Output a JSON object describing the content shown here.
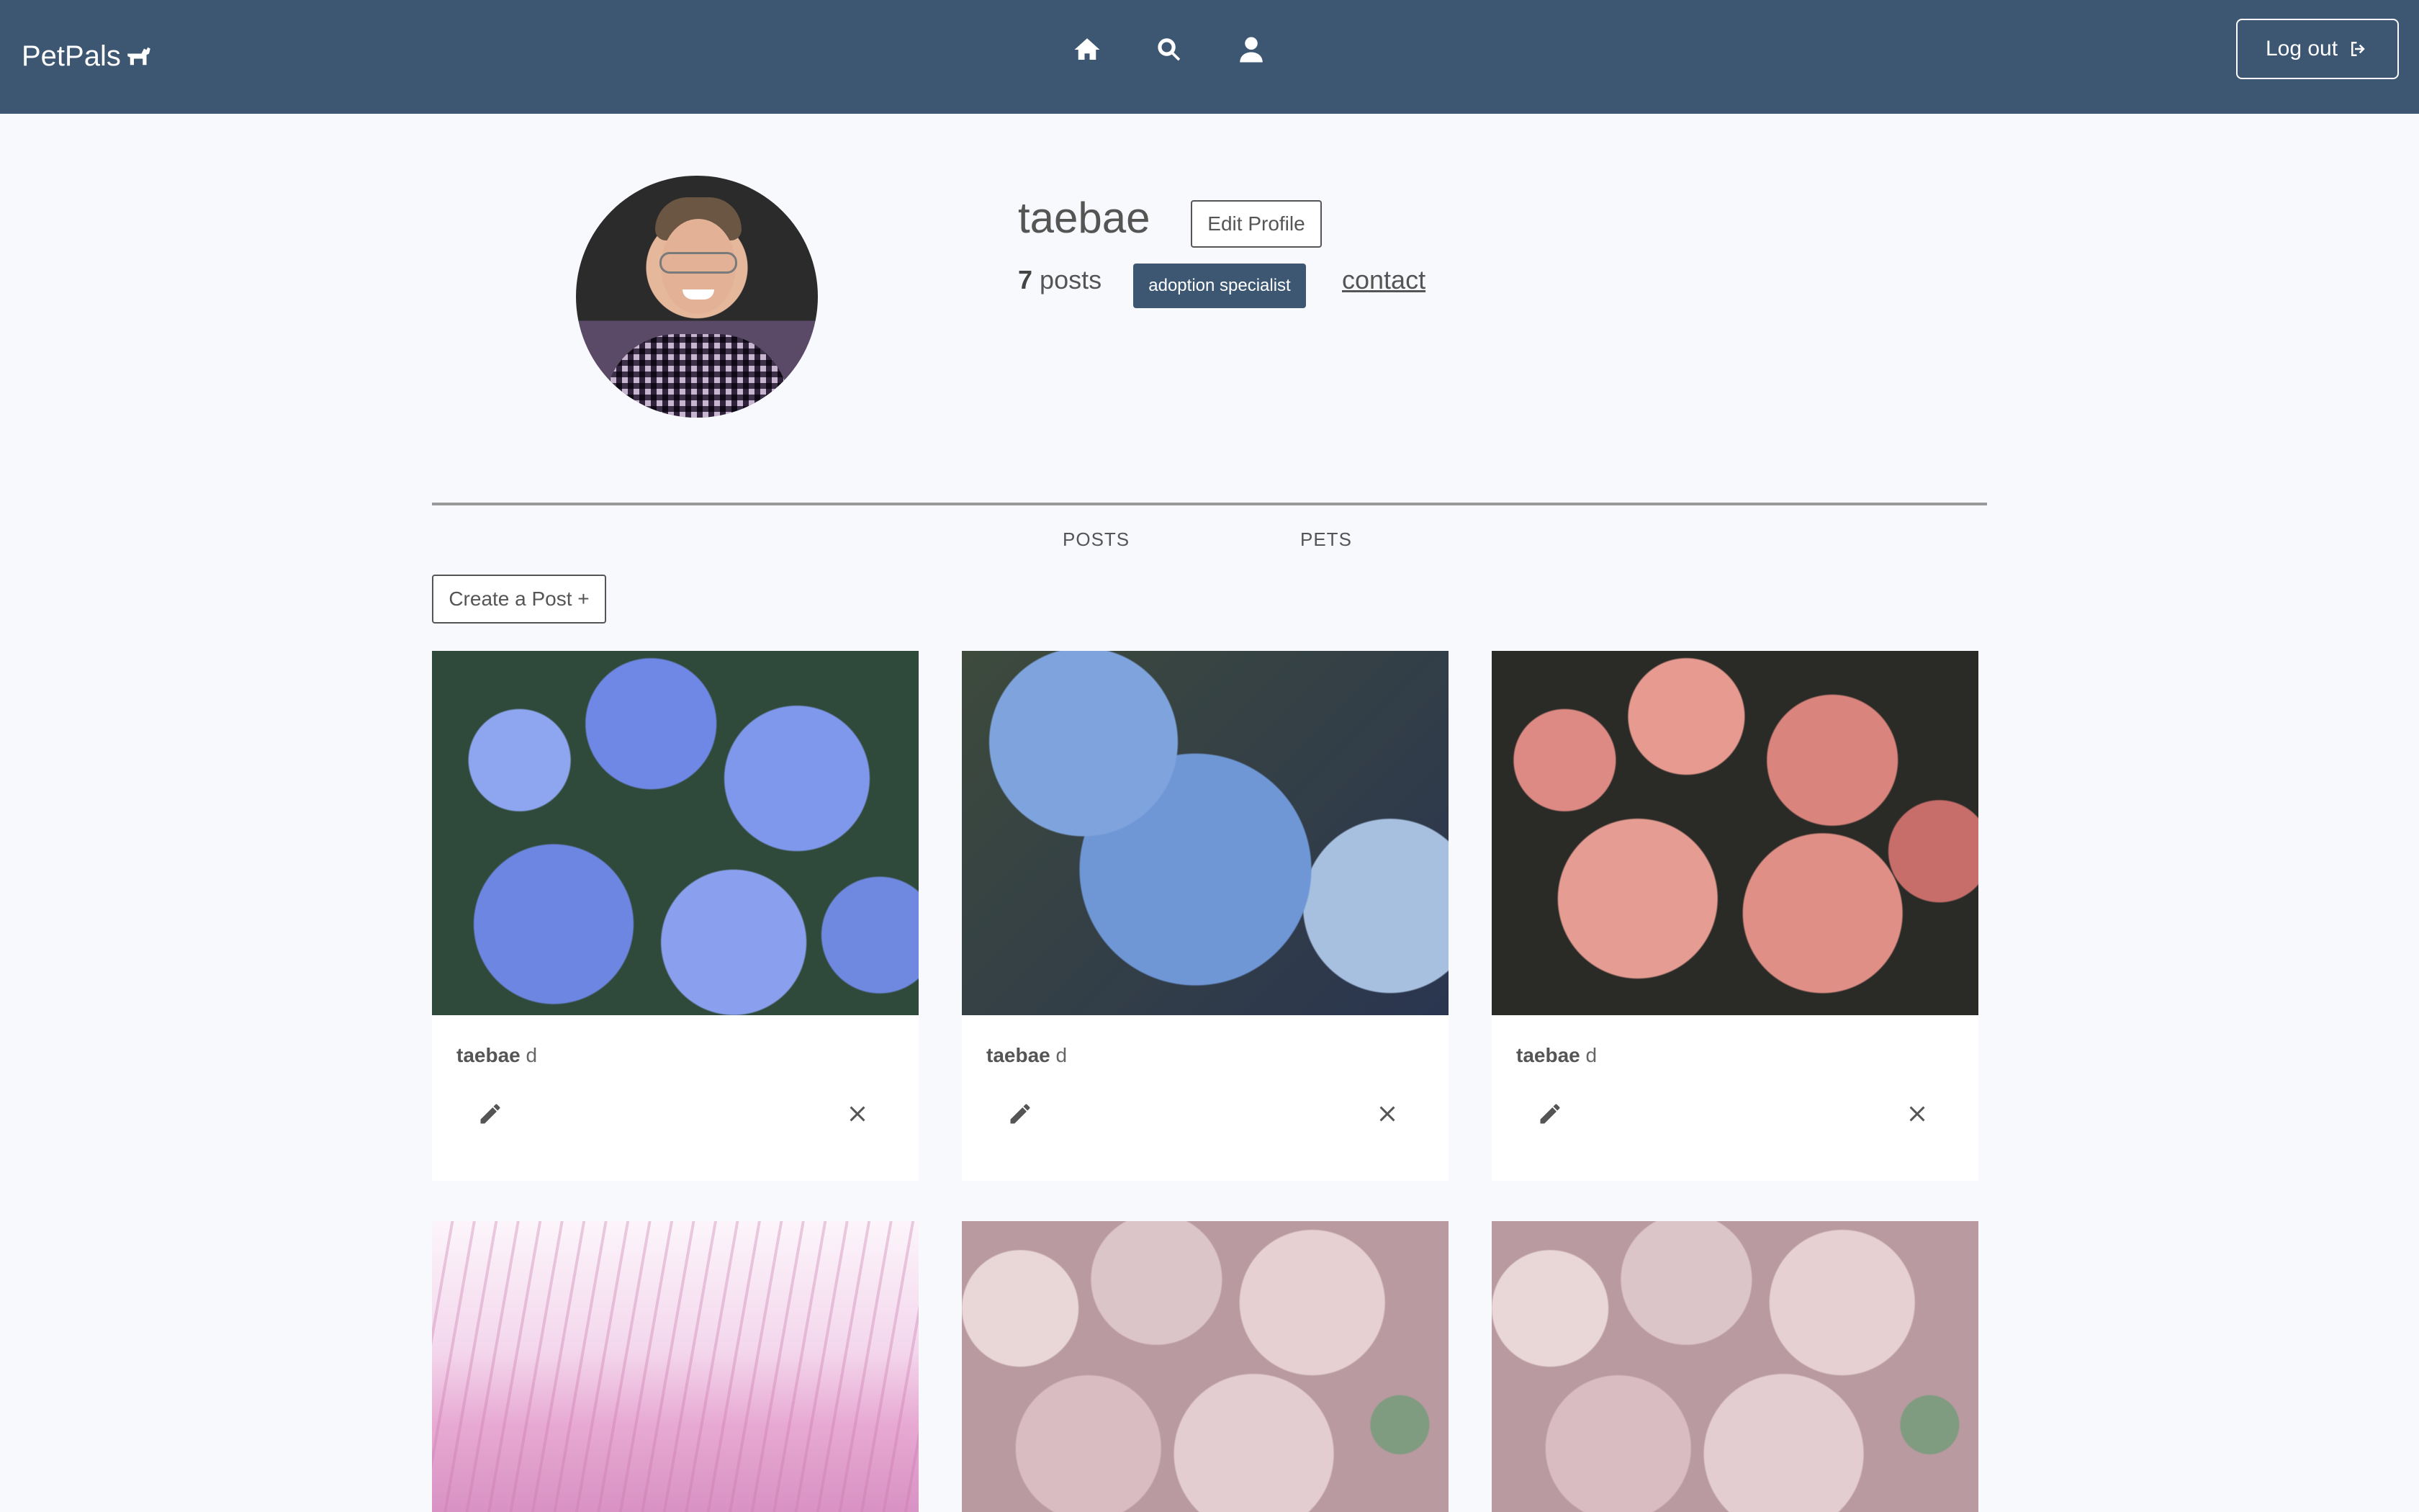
{
  "nav": {
    "brand": "PetPals",
    "icons": [
      "home-icon",
      "search-icon",
      "user-icon"
    ],
    "logout_label": "Log out"
  },
  "profile": {
    "username": "taebae",
    "edit_label": "Edit Profile",
    "posts_count": "7",
    "posts_word": "posts",
    "role": "adoption specialist",
    "contact_label": "contact"
  },
  "tabs": {
    "posts": "POSTS",
    "pets": "PETS"
  },
  "create_post_label": "Create a Post +",
  "posts": [
    {
      "author": "taebae",
      "suffix": "d"
    },
    {
      "author": "taebae",
      "suffix": "d"
    },
    {
      "author": "taebae",
      "suffix": "d"
    },
    {
      "author": "",
      "suffix": ""
    },
    {
      "author": "",
      "suffix": ""
    },
    {
      "author": "",
      "suffix": ""
    }
  ],
  "colors": {
    "navbar": "#3d5773",
    "badge": "#3d5773",
    "page_bg": "#f8f9fc"
  }
}
